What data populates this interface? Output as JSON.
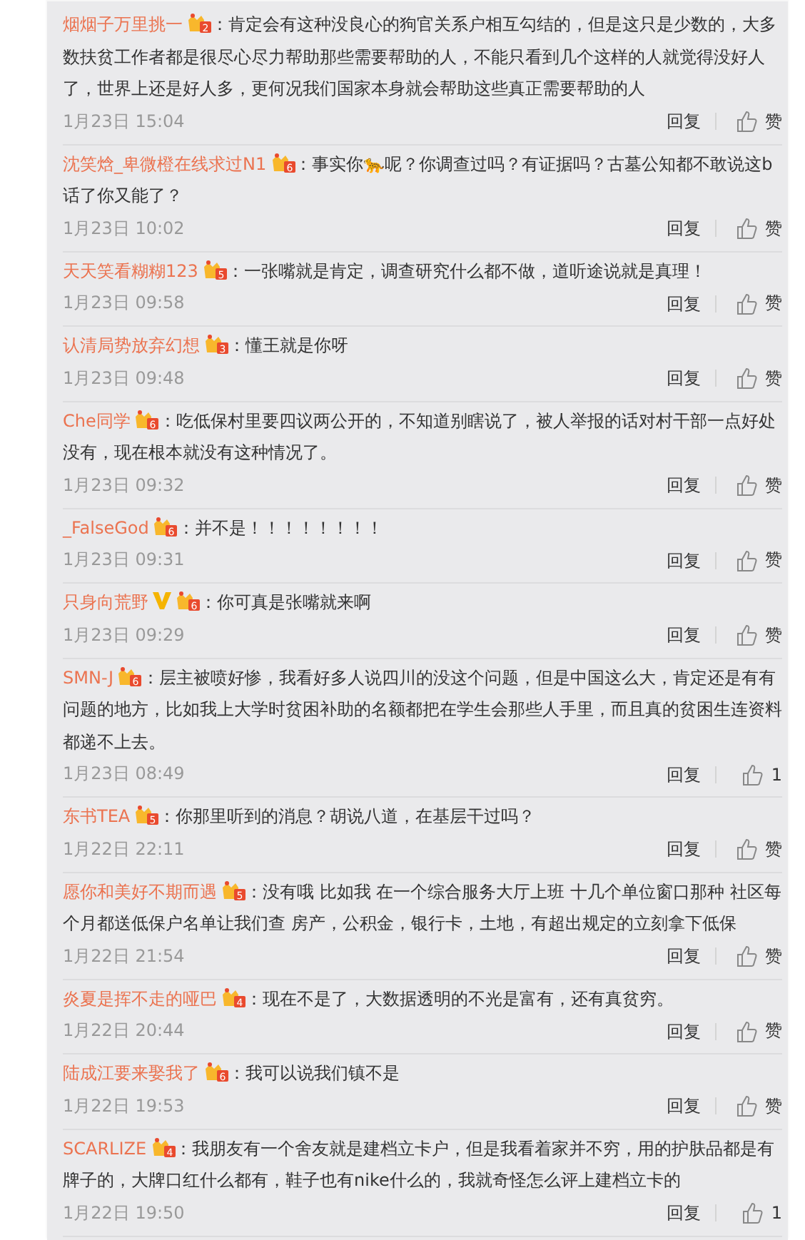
{
  "comments": [
    {
      "user": "烟烟子万里挑一",
      "level": "2",
      "verified": false,
      "text": "：肯定会有这种没良心的狗官关系户相互勾结的，但是这只是少数的，大多数扶贫工作者都是很尽心尽力帮助那些需要帮助的人，不能只看到几个这样的人就觉得没好人了，世界上还是好人多，更何况我们国家本身就会帮助这些真正需要帮助的人",
      "time": "1月23日 15:04",
      "reply": "回复",
      "likes": "赞"
    },
    {
      "user": "沈笑焓_卑微橙在线求过N1",
      "level": "6",
      "verified": false,
      "text": "：事实你🐆呢？你调查过吗？有证据吗？古墓公知都不敢说这b话了你又能了？",
      "time": "1月23日 10:02",
      "reply": "回复",
      "likes": "赞"
    },
    {
      "user": "天天笑看糊糊123",
      "level": "5",
      "verified": false,
      "text": "：一张嘴就是肯定，调查研究什么都不做，道听途说就是真理！",
      "time": "1月23日 09:58",
      "reply": "回复",
      "likes": "赞"
    },
    {
      "user": "认清局势放弃幻想",
      "level": "3",
      "verified": false,
      "text": "：懂王就是你呀",
      "time": "1月23日 09:48",
      "reply": "回复",
      "likes": "赞"
    },
    {
      "user": "Che同学",
      "level": "6",
      "verified": false,
      "text": "：吃低保村里要四议两公开的，不知道别瞎说了，被人举报的话对村干部一点好处没有，现在根本就没有这种情况了。",
      "time": "1月23日 09:32",
      "reply": "回复",
      "likes": "赞"
    },
    {
      "user": "_FalseGod",
      "level": "6",
      "verified": false,
      "text": "：并不是！！！！！！！！",
      "time": "1月23日 09:31",
      "reply": "回复",
      "likes": "赞"
    },
    {
      "user": "只身向荒野",
      "level": "6",
      "verified": true,
      "text": "：你可真是张嘴就来啊",
      "time": "1月23日 09:29",
      "reply": "回复",
      "likes": "赞"
    },
    {
      "user": "SMN-J",
      "level": "6",
      "verified": false,
      "text": "：层主被喷好惨，我看好多人说四川的没这个问题，但是中国这么大，肯定还是有有问题的地方，比如我上大学时贫困补助的名额都把在学生会那些人手里，而且真的贫困生连资料都递不上去。",
      "time": "1月23日 08:49",
      "reply": "回复",
      "likes": "1"
    },
    {
      "user": "东书TEA",
      "level": "5",
      "verified": false,
      "text": "：你那里听到的消息？胡说八道，在基层干过吗？",
      "time": "1月22日 22:11",
      "reply": "回复",
      "likes": "赞"
    },
    {
      "user": "愿你和美好不期而遇",
      "level": "5",
      "verified": false,
      "text": "：没有哦 比如我 在一个综合服务大厅上班 十几个单位窗口那种 社区每个月都送低保户名单让我们查 房产，公积金，银行卡，土地，有超出规定的立刻拿下低保",
      "time": "1月22日 21:54",
      "reply": "回复",
      "likes": "赞"
    },
    {
      "user": "炎夏是挥不走的哑巴",
      "level": "4",
      "verified": false,
      "text": "：现在不是了，大数据透明的不光是富有，还有真贫穷。",
      "time": "1月22日 20:44",
      "reply": "回复",
      "likes": "赞"
    },
    {
      "user": "陆成江要来娶我了",
      "level": "6",
      "verified": false,
      "text": "：我可以说我们镇不是",
      "time": "1月22日 19:53",
      "reply": "回复",
      "likes": "赞"
    },
    {
      "user": "SCARLIZE",
      "level": "4",
      "verified": false,
      "text": "：我朋友有一个舍友就是建档立卡户，但是我看着家并不穷，用的护肤品都是有牌子的，大牌口红什么都有，鞋子也有nike什么的，我就奇怪怎么评上建档立卡的",
      "time": "1月22日 19:50",
      "reply": "回复",
      "likes": "1"
    }
  ]
}
